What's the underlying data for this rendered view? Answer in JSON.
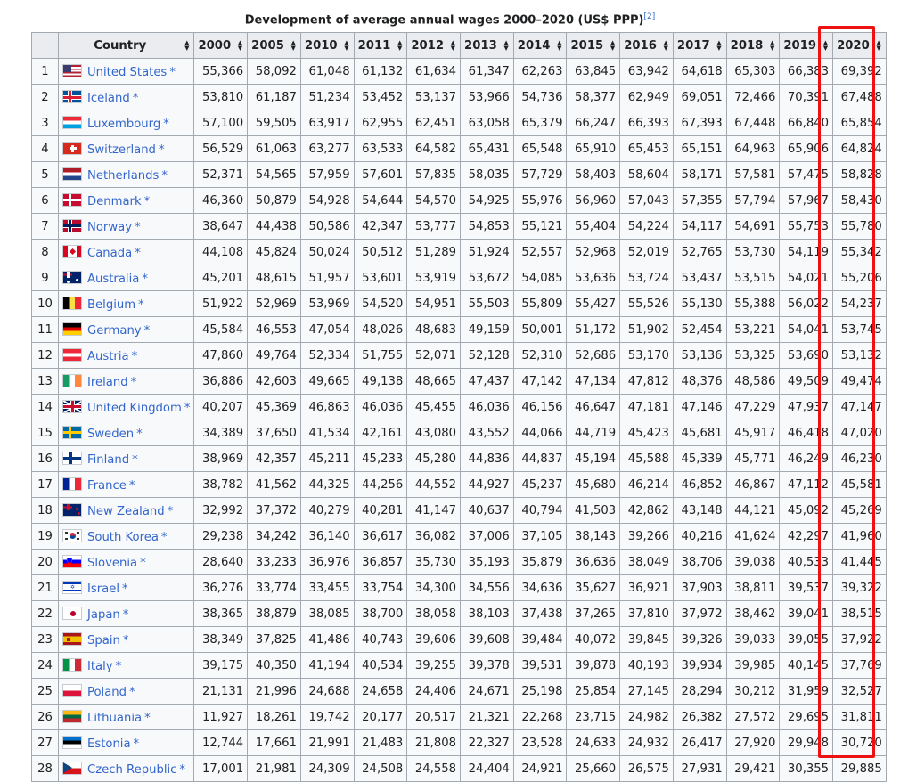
{
  "caption": {
    "text": "Development of average annual wages 2000–2020 (US$ PPP)",
    "ref": "[2]"
  },
  "columns": [
    "Country",
    "2000",
    "2005",
    "2010",
    "2011",
    "2012",
    "2013",
    "2014",
    "2015",
    "2016",
    "2017",
    "2018",
    "2019",
    "2020"
  ],
  "rows": [
    {
      "rank": "1",
      "country": "United States",
      "flag": "us",
      "values": [
        "55,366",
        "58,092",
        "61,048",
        "61,132",
        "61,634",
        "61,347",
        "62,263",
        "63,845",
        "63,942",
        "64,618",
        "65,303",
        "66,383",
        "69,392"
      ]
    },
    {
      "rank": "2",
      "country": "Iceland",
      "flag": "is",
      "values": [
        "53,810",
        "61,187",
        "51,234",
        "53,452",
        "53,137",
        "53,966",
        "54,736",
        "58,377",
        "62,949",
        "69,051",
        "72,466",
        "70,391",
        "67,488"
      ]
    },
    {
      "rank": "3",
      "country": "Luxembourg",
      "flag": "lu",
      "values": [
        "57,100",
        "59,505",
        "63,917",
        "62,955",
        "62,451",
        "63,058",
        "65,379",
        "66,247",
        "66,393",
        "67,393",
        "67,448",
        "66,840",
        "65,854"
      ]
    },
    {
      "rank": "4",
      "country": "Switzerland",
      "flag": "ch",
      "values": [
        "56,529",
        "61,063",
        "63,277",
        "63,533",
        "64,582",
        "65,431",
        "65,548",
        "65,910",
        "65,453",
        "65,151",
        "64,963",
        "65,906",
        "64,824"
      ]
    },
    {
      "rank": "5",
      "country": "Netherlands",
      "flag": "nl",
      "values": [
        "52,371",
        "54,565",
        "57,959",
        "57,601",
        "57,835",
        "58,035",
        "57,729",
        "58,403",
        "58,604",
        "58,171",
        "57,581",
        "57,475",
        "58,828"
      ]
    },
    {
      "rank": "6",
      "country": "Denmark",
      "flag": "dk",
      "values": [
        "46,360",
        "50,879",
        "54,928",
        "54,644",
        "54,570",
        "54,925",
        "55,976",
        "56,960",
        "57,043",
        "57,355",
        "57,794",
        "57,967",
        "58,430"
      ]
    },
    {
      "rank": "7",
      "country": "Norway",
      "flag": "no",
      "values": [
        "38,647",
        "44,438",
        "50,586",
        "42,347",
        "53,777",
        "54,853",
        "55,121",
        "55,404",
        "54,224",
        "54,117",
        "54,691",
        "55,753",
        "55,780"
      ]
    },
    {
      "rank": "8",
      "country": "Canada",
      "flag": "ca",
      "values": [
        "44,108",
        "45,824",
        "50,024",
        "50,512",
        "51,289",
        "51,924",
        "52,557",
        "52,968",
        "52,019",
        "52,765",
        "53,730",
        "54,119",
        "55,342"
      ]
    },
    {
      "rank": "9",
      "country": "Australia",
      "flag": "au",
      "values": [
        "45,201",
        "48,615",
        "51,957",
        "53,601",
        "53,919",
        "53,672",
        "54,085",
        "53,636",
        "53,724",
        "53,437",
        "53,515",
        "54,021",
        "55,206"
      ]
    },
    {
      "rank": "10",
      "country": "Belgium",
      "flag": "be",
      "values": [
        "51,922",
        "52,969",
        "53,969",
        "54,520",
        "54,951",
        "55,503",
        "55,809",
        "55,427",
        "55,526",
        "55,130",
        "55,388",
        "56,022",
        "54,237"
      ]
    },
    {
      "rank": "11",
      "country": "Germany",
      "flag": "de",
      "values": [
        "45,584",
        "46,553",
        "47,054",
        "48,026",
        "48,683",
        "49,159",
        "50,001",
        "51,172",
        "51,902",
        "52,454",
        "53,221",
        "54,041",
        "53,745"
      ]
    },
    {
      "rank": "12",
      "country": "Austria",
      "flag": "at",
      "values": [
        "47,860",
        "49,764",
        "52,334",
        "51,755",
        "52,071",
        "52,128",
        "52,310",
        "52,686",
        "53,170",
        "53,136",
        "53,325",
        "53,690",
        "53,132"
      ]
    },
    {
      "rank": "13",
      "country": "Ireland",
      "flag": "ie",
      "values": [
        "36,886",
        "42,603",
        "49,665",
        "49,138",
        "48,665",
        "47,437",
        "47,142",
        "47,134",
        "47,812",
        "48,376",
        "48,586",
        "49,509",
        "49,474"
      ]
    },
    {
      "rank": "14",
      "country": "United Kingdom",
      "flag": "gb",
      "values": [
        "40,207",
        "45,369",
        "46,863",
        "46,036",
        "45,455",
        "46,036",
        "46,156",
        "46,647",
        "47,181",
        "47,146",
        "47,229",
        "47,937",
        "47,147"
      ]
    },
    {
      "rank": "15",
      "country": "Sweden",
      "flag": "se",
      "values": [
        "34,389",
        "37,650",
        "41,534",
        "42,161",
        "43,080",
        "43,552",
        "44,066",
        "44,719",
        "45,423",
        "45,681",
        "45,917",
        "46,418",
        "47,020"
      ]
    },
    {
      "rank": "16",
      "country": "Finland",
      "flag": "fi",
      "values": [
        "38,969",
        "42,357",
        "45,211",
        "45,233",
        "45,280",
        "44,836",
        "44,837",
        "45,194",
        "45,588",
        "45,339",
        "45,771",
        "46,249",
        "46,230"
      ]
    },
    {
      "rank": "17",
      "country": "France",
      "flag": "fr",
      "values": [
        "38,782",
        "41,562",
        "44,325",
        "44,256",
        "44,552",
        "44,927",
        "45,237",
        "45,680",
        "46,214",
        "46,852",
        "46,867",
        "47,112",
        "45,581"
      ]
    },
    {
      "rank": "18",
      "country": "New Zealand",
      "flag": "nz",
      "values": [
        "32,992",
        "37,372",
        "40,279",
        "40,281",
        "41,147",
        "40,637",
        "40,794",
        "41,503",
        "42,862",
        "43,148",
        "44,121",
        "45,092",
        "45,269"
      ]
    },
    {
      "rank": "19",
      "country": "South Korea",
      "flag": "kr",
      "values": [
        "29,238",
        "34,242",
        "36,140",
        "36,617",
        "36,082",
        "37,006",
        "37,105",
        "38,143",
        "39,266",
        "40,216",
        "41,624",
        "42,297",
        "41,960"
      ]
    },
    {
      "rank": "20",
      "country": "Slovenia",
      "flag": "si",
      "values": [
        "28,640",
        "33,233",
        "36,976",
        "36,857",
        "35,730",
        "35,193",
        "35,879",
        "36,636",
        "38,049",
        "38,706",
        "39,038",
        "40,533",
        "41,445"
      ]
    },
    {
      "rank": "21",
      "country": "Israel",
      "flag": "il",
      "values": [
        "36,276",
        "33,774",
        "33,455",
        "33,754",
        "34,300",
        "34,556",
        "34,636",
        "35,627",
        "36,921",
        "37,903",
        "38,811",
        "39,537",
        "39,322"
      ]
    },
    {
      "rank": "22",
      "country": "Japan",
      "flag": "jp",
      "values": [
        "38,365",
        "38,879",
        "38,085",
        "38,700",
        "38,058",
        "38,103",
        "37,438",
        "37,265",
        "37,810",
        "37,972",
        "38,462",
        "39,041",
        "38,515"
      ]
    },
    {
      "rank": "23",
      "country": "Spain",
      "flag": "es",
      "values": [
        "38,349",
        "37,825",
        "41,486",
        "40,743",
        "39,606",
        "39,608",
        "39,484",
        "40,072",
        "39,845",
        "39,326",
        "39,033",
        "39,055",
        "37,922"
      ]
    },
    {
      "rank": "24",
      "country": "Italy",
      "flag": "it",
      "values": [
        "39,175",
        "40,350",
        "41,194",
        "40,534",
        "39,255",
        "39,378",
        "39,531",
        "39,878",
        "40,193",
        "39,934",
        "39,985",
        "40,145",
        "37,769"
      ]
    },
    {
      "rank": "25",
      "country": "Poland",
      "flag": "pl",
      "values": [
        "21,131",
        "21,996",
        "24,688",
        "24,658",
        "24,406",
        "24,671",
        "25,198",
        "25,854",
        "27,145",
        "28,294",
        "30,212",
        "31,959",
        "32,527"
      ]
    },
    {
      "rank": "26",
      "country": "Lithuania",
      "flag": "lt",
      "values": [
        "11,927",
        "18,261",
        "19,742",
        "20,177",
        "20,517",
        "21,321",
        "22,268",
        "23,715",
        "24,982",
        "26,382",
        "27,572",
        "29,695",
        "31,811"
      ]
    },
    {
      "rank": "27",
      "country": "Estonia",
      "flag": "ee",
      "values": [
        "12,744",
        "17,661",
        "21,991",
        "21,483",
        "21,808",
        "22,327",
        "23,528",
        "24,633",
        "24,932",
        "26,417",
        "27,920",
        "29,948",
        "30,720"
      ]
    },
    {
      "rank": "28",
      "country": "Czech Republic",
      "flag": "cz",
      "values": [
        "17,001",
        "21,981",
        "24,309",
        "24,508",
        "24,558",
        "24,404",
        "24,921",
        "25,660",
        "26,575",
        "27,931",
        "29,421",
        "30,355",
        "29,885"
      ]
    }
  ]
}
